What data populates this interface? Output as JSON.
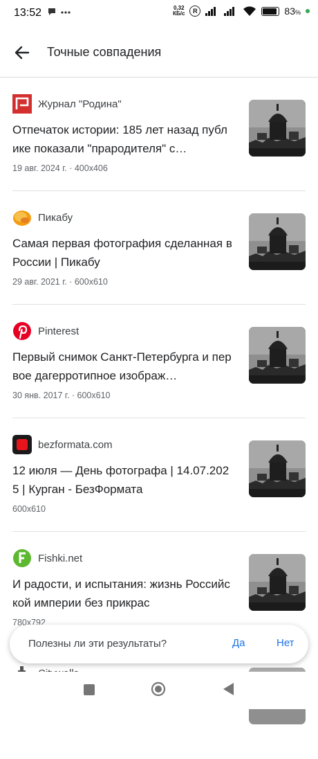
{
  "status_bar": {
    "time": "13:52",
    "net_speed_value": "0,32",
    "net_speed_unit": "КБ/с",
    "roaming": "R",
    "battery": "83",
    "battery_suffix": "%"
  },
  "header": {
    "title": "Точные совпадения"
  },
  "results": [
    {
      "source": "Журнал \"Родина\"",
      "title": "Отпечаток истории: 185 лет назад публике показали \"прародителя\" с…",
      "meta": "19 авг. 2024 г. · 400x406",
      "favicon": "rodina-icon"
    },
    {
      "source": "Пикабу",
      "title": "Самая первая фотография сделанная в России | Пикабу",
      "meta": "29 авг. 2021 г. · 600x610",
      "favicon": "pikabu-icon"
    },
    {
      "source": "Pinterest",
      "title": "Первый снимок Санкт-Петербурга и первое дагерротипное изображ…",
      "meta": "30 янв. 2017 г. · 600x610",
      "favicon": "pinterest-icon"
    },
    {
      "source": "bezformata.com",
      "title": "12 июля — День фотографа | 14.07.2025 | Курган - БезФормата",
      "meta": "600x610",
      "favicon": "bezformata-icon"
    },
    {
      "source": "Fishki.net",
      "title": "И радости, и испытания: жизнь Российской империи без прикрас",
      "meta": "780x792",
      "favicon": "fishki-icon"
    },
    {
      "source": "Citywalls",
      "title": "",
      "meta": "",
      "favicon": "citywalls-icon"
    }
  ],
  "feedback": {
    "question": "Полезны ли эти результаты?",
    "yes": "Да",
    "no": "Нет"
  },
  "colors": {
    "accent": "#1a73e8",
    "text": "#202124",
    "secondary_text": "#5f6368",
    "battery_dot": "#34a853"
  }
}
